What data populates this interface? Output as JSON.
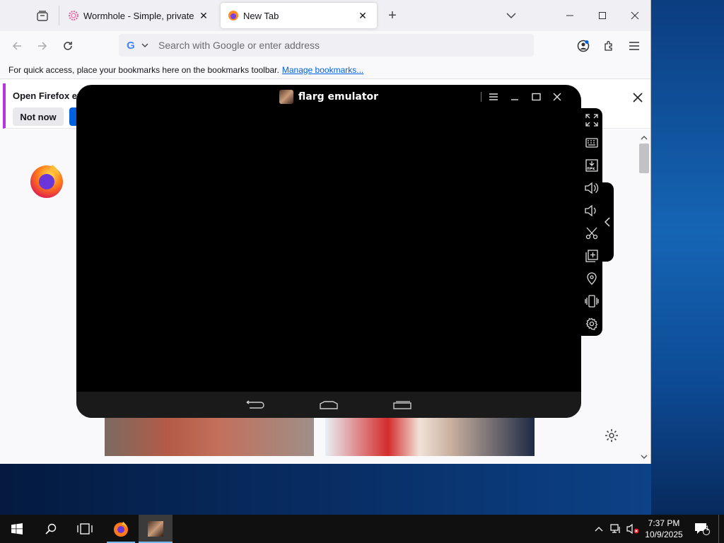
{
  "firefox": {
    "tabs": [
      {
        "title": "Wormhole - Simple, private file",
        "active": false
      },
      {
        "title": "New Tab",
        "active": true
      }
    ],
    "new_tab_symbol": "+",
    "url_placeholder": "Search with Google or enter address",
    "search_engine_glyph": "G",
    "bookmarks_bar_text": "For quick access, place your bookmarks here on the bookmarks toolbar.",
    "bookmarks_bar_link": "Manage bookmarks...",
    "notice": {
      "text": "Open Firefox ever",
      "not_now_label": "Not now"
    }
  },
  "emulator": {
    "title": "flarg emulator",
    "side_icons": [
      "fullscreen-icon",
      "keyboard-icon",
      "apk-install-icon",
      "volume-up-icon",
      "volume-down-icon",
      "screenshot-scissors-icon",
      "multi-instance-icon",
      "location-icon",
      "shake-icon",
      "settings-icon"
    ]
  },
  "taskbar": {
    "time": "7:37 PM",
    "date": "10/9/2025",
    "notification_count": "1"
  },
  "colors": {
    "accent": "#0061e0",
    "notice_border": "#b833e1",
    "taskbar": "#101010"
  }
}
